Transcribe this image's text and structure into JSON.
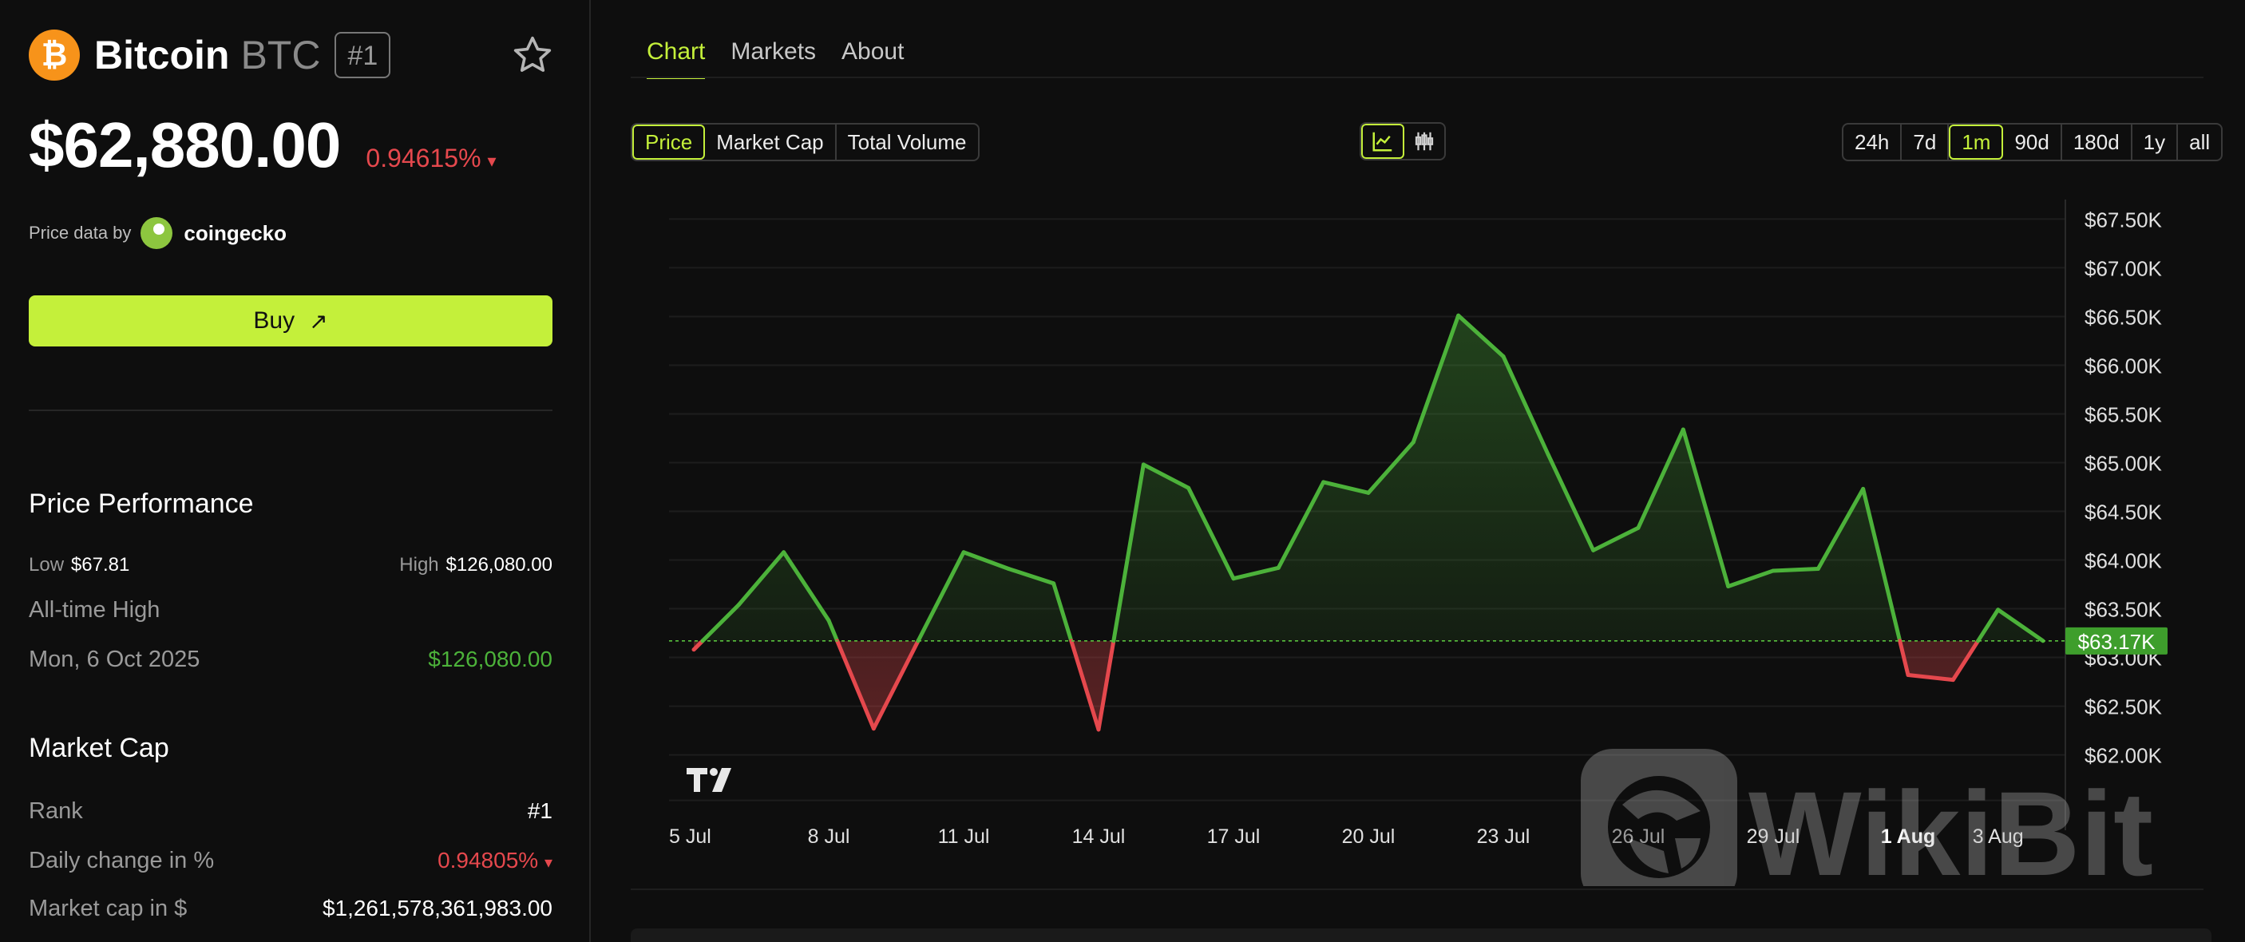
{
  "coin": {
    "logo_glyph": "₿",
    "name": "Bitcoin",
    "symbol": "BTC",
    "rank": "#1",
    "price": "$62,880.00",
    "change": "0.94615%",
    "change_arrow": "▾"
  },
  "price_data": {
    "label": "Price data by",
    "source": "coingecko"
  },
  "buy": {
    "label": "Buy",
    "arrow": "↗"
  },
  "performance": {
    "title": "Price Performance",
    "low_label": "Low",
    "low_value": "$67.81",
    "high_label": "High",
    "high_value": "$126,080.00",
    "ath_label": "All-time High",
    "ath_date": "Mon, 6 Oct 2025",
    "ath_value": "$126,080.00"
  },
  "market_cap": {
    "title": "Market Cap",
    "rank_label": "Rank",
    "rank_value": "#1",
    "daily_label": "Daily change in %",
    "daily_value": "0.94805%",
    "daily_arrow": "▾",
    "cap_label": "Market cap in $",
    "cap_value": "$1,261,578,361,983.00"
  },
  "tabs": [
    "Chart",
    "Markets",
    "About"
  ],
  "metric_tabs": [
    "Price",
    "Market Cap",
    "Total Volume"
  ],
  "range_tabs": [
    "24h",
    "7d",
    "1m",
    "90d",
    "180d",
    "1y",
    "all"
  ],
  "colors": {
    "accent": "#c4f03a",
    "up": "#4cb23a",
    "down": "#e5484d",
    "btc": "#f7931a"
  },
  "icons": {
    "chart_type": [
      "line-chart-icon",
      "candlestick-icon"
    ],
    "watermark": "WikiBit"
  },
  "chart_data": {
    "type": "line",
    "x": [
      "5 Jul",
      "6 Jul",
      "7 Jul",
      "8 Jul",
      "9 Jul",
      "10 Jul",
      "11 Jul",
      "12 Jul",
      "13 Jul",
      "14 Jul",
      "15 Jul",
      "16 Jul",
      "17 Jul",
      "18 Jul",
      "19 Jul",
      "20 Jul",
      "21 Jul",
      "22 Jul",
      "23 Jul",
      "24 Jul",
      "25 Jul",
      "26 Jul",
      "27 Jul",
      "28 Jul",
      "29 Jul",
      "30 Jul",
      "31 Jul",
      "1 Aug",
      "2 Aug",
      "3 Aug",
      "4 Aug"
    ],
    "values": [
      63080,
      63540,
      64080,
      63380,
      62270,
      63180,
      64080,
      63910,
      63760,
      62260,
      64980,
      64740,
      63810,
      63920,
      64800,
      64690,
      65210,
      66510,
      66090,
      65080,
      64100,
      64330,
      65340,
      63730,
      63890,
      63910,
      64730,
      62820,
      62770,
      63490,
      63170
    ],
    "baseline": 63170,
    "last_label": "$63.17K",
    "ylim": [
      61800,
      67700
    ],
    "yticks": [
      62000,
      62500,
      63000,
      63500,
      64000,
      64500,
      65000,
      65500,
      66000,
      66500,
      67000,
      67500
    ],
    "ytick_labels": [
      "$62.00K",
      "$62.50K",
      "$63.00K",
      "$63.50K",
      "$64.00K",
      "$64.50K",
      "$65.00K",
      "$65.50K",
      "$66.00K",
      "$66.50K",
      "$67.00K",
      "$67.50K"
    ],
    "xticks": [
      "5 Jul",
      "8 Jul",
      "11 Jul",
      "14 Jul",
      "17 Jul",
      "20 Jul",
      "23 Jul",
      "26 Jul",
      "29 Jul",
      "1 Aug",
      "3 Aug"
    ],
    "highlight_tick": "1 Aug",
    "grid": true,
    "logo": "TV"
  }
}
